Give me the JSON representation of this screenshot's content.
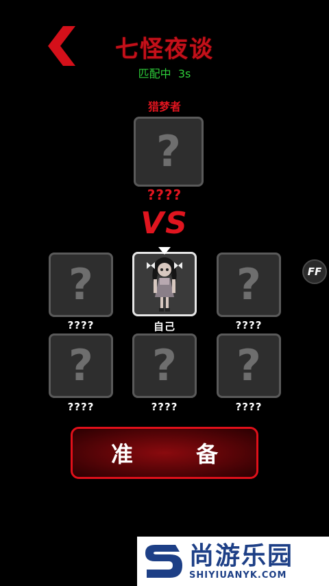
{
  "header": {
    "title": "七怪夜谈",
    "status": "匹配中  3s"
  },
  "hunter": {
    "role_label": "猎梦者",
    "slot_symbol": "?",
    "name": "????"
  },
  "vs_text": "VS",
  "players": [
    {
      "name": "????",
      "symbol": "?"
    },
    {
      "name": "自己",
      "symbol": ""
    },
    {
      "name": "????",
      "symbol": "?"
    },
    {
      "name": "????",
      "symbol": "?"
    },
    {
      "name": "????",
      "symbol": "?"
    },
    {
      "name": "????",
      "symbol": "?"
    }
  ],
  "ff_button": "FF",
  "ready_button": {
    "left": "准",
    "right": "备"
  },
  "watermark": {
    "cn": "尚游乐园",
    "en": "SHIYIUANYK.COM"
  },
  "colors": {
    "accent_red": "#e0151f",
    "status_green": "#2ecf3a",
    "watermark_blue": "#1d3f86"
  }
}
